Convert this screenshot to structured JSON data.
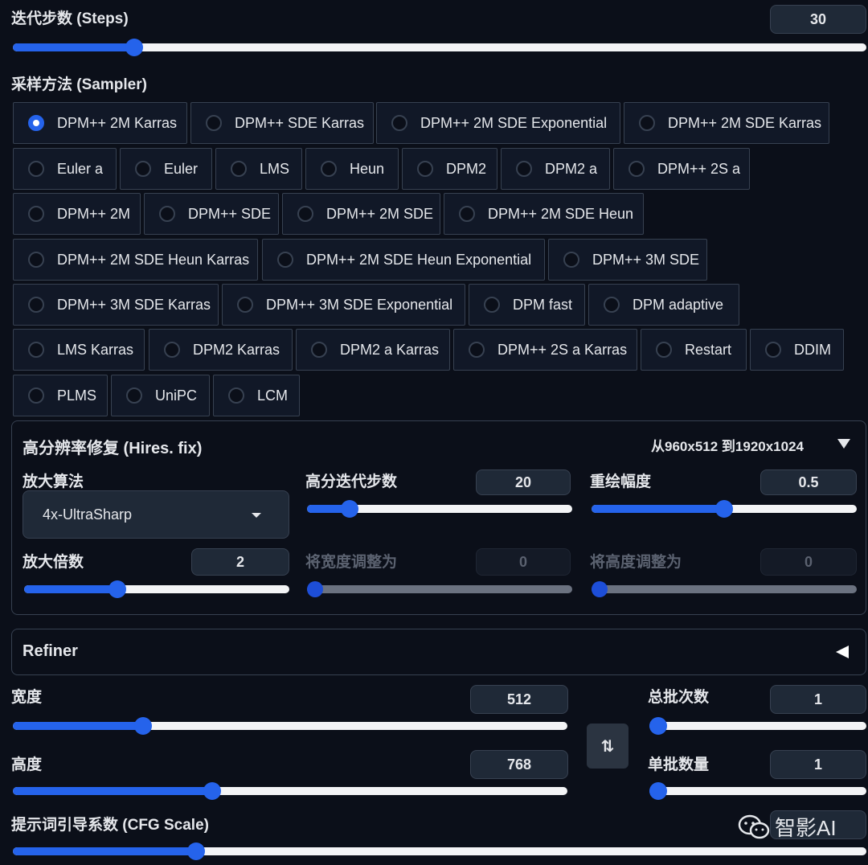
{
  "steps": {
    "label": "迭代步数 (Steps)",
    "value": "30",
    "fraction": 0.142
  },
  "sampler": {
    "label": "采样方法 (Sampler)",
    "selected": "DPM++ 2M Karras",
    "options": [
      "DPM++ 2M Karras",
      "DPM++ SDE Karras",
      "DPM++ 2M SDE Exponential",
      "DPM++ 2M SDE Karras",
      "Euler a",
      "Euler",
      "LMS",
      "Heun",
      "DPM2",
      "DPM2 a",
      "DPM++ 2S a",
      "DPM++ 2M",
      "DPM++ SDE",
      "DPM++ 2M SDE",
      "DPM++ 2M SDE Heun",
      "DPM++ 2M SDE Heun Karras",
      "DPM++ 2M SDE Heun Exponential",
      "DPM++ 3M SDE",
      "DPM++ 3M SDE Karras",
      "DPM++ 3M SDE Exponential",
      "DPM fast",
      "DPM adaptive",
      "LMS Karras",
      "DPM2 Karras",
      "DPM2 a Karras",
      "DPM++ 2S a Karras",
      "Restart",
      "DDIM",
      "PLMS",
      "UniPC",
      "LCM"
    ]
  },
  "hires": {
    "title": "高分辨率修复 (Hires. fix)",
    "summary": "从960x512 到1920x1024",
    "toggle_icon": "triangle-down-icon",
    "upscaler_label": "放大算法",
    "upscaler_value": "4x-UltraSharp",
    "steps_label": "高分迭代步数",
    "steps_value": "20",
    "steps_fraction": 0.16,
    "denoise_label": "重绘幅度",
    "denoise_value": "0.5",
    "denoise_fraction": 0.5,
    "scale_label": "放大倍数",
    "scale_value": "2",
    "scale_fraction": 0.35,
    "resize_w_label": "将宽度调整为",
    "resize_w_value": "0",
    "resize_h_label": "将高度调整为",
    "resize_h_value": "0"
  },
  "refiner": {
    "title": "Refiner",
    "toggle_icon": "triangle-left-icon"
  },
  "width": {
    "label": "宽度",
    "value": "512",
    "fraction": 0.235
  },
  "height": {
    "label": "高度",
    "value": "768",
    "fraction": 0.36
  },
  "batch_count": {
    "label": "总批次数",
    "value": "1",
    "fraction": 0.0
  },
  "batch_size": {
    "label": "单批数量",
    "value": "1",
    "fraction": 0.0
  },
  "swap_icon": "swap-vertical-icon",
  "swap_glyph": "⇅",
  "cfg": {
    "label": "提示词引导系数 (CFG Scale)",
    "fraction": 0.215
  },
  "watermark": {
    "text": "智影AI",
    "icon": "wechat-icon"
  }
}
